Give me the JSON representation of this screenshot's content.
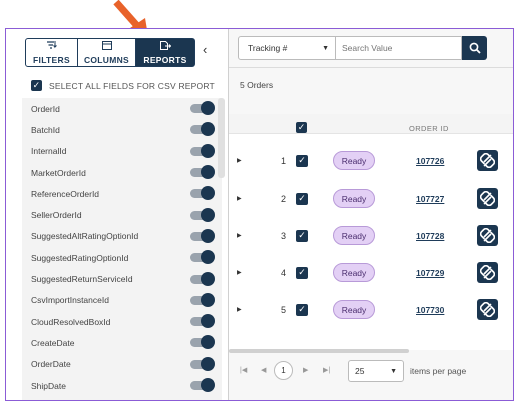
{
  "tabs": [
    {
      "label": "FILTERS",
      "icon": "filter-icon"
    },
    {
      "label": "COLUMNS",
      "icon": "columns-icon"
    },
    {
      "label": "REPORTS",
      "icon": "report-export-icon"
    }
  ],
  "collapse_glyph": "‹",
  "select_all_label": "SELECT ALL FIELDS FOR CSV REPORT",
  "fields": [
    "OrderId",
    "BatchId",
    "InternalId",
    "MarketOrderId",
    "ReferenceOrderId",
    "SellerOrderId",
    "SuggestedAltRatingOptionId",
    "SuggestedRatingOptionId",
    "SuggestedReturnServiceId",
    "CsvImportInstanceId",
    "CloudResolvedBoxId",
    "CreateDate",
    "OrderDate",
    "ShipDate"
  ],
  "search": {
    "field_selected": "Tracking #",
    "placeholder": "Search Value"
  },
  "orders_count": "5 Orders",
  "grid": {
    "header_order_id": "ORDER ID",
    "rows": [
      {
        "num": "1",
        "status": "Ready",
        "order_id": "107726"
      },
      {
        "num": "2",
        "status": "Ready",
        "order_id": "107727"
      },
      {
        "num": "3",
        "status": "Ready",
        "order_id": "107728"
      },
      {
        "num": "4",
        "status": "Ready",
        "order_id": "107729"
      },
      {
        "num": "5",
        "status": "Ready",
        "order_id": "107730"
      }
    ]
  },
  "pager": {
    "current_page": "1",
    "page_size": "25",
    "items_per_page_label": "items per page"
  },
  "colors": {
    "navy": "#1b3650",
    "frame_purple": "#8b5cd6",
    "arrow_orange": "#e8622a",
    "ready_pill": "#e3d0f5"
  }
}
